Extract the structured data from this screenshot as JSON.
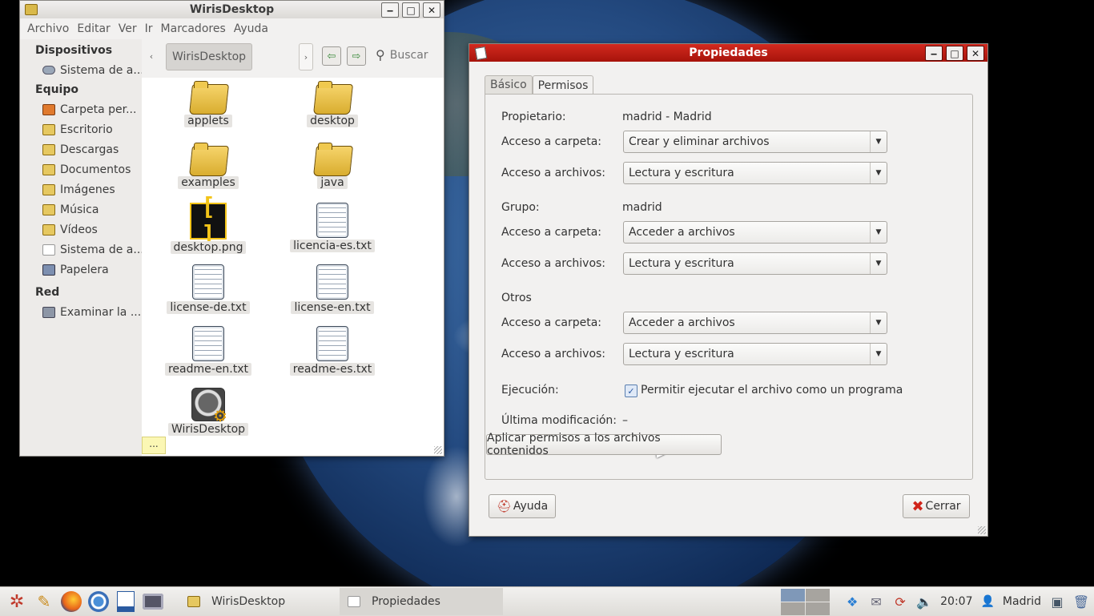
{
  "file_manager": {
    "title": "WirisDesktop",
    "menu": [
      "Archivo",
      "Editar",
      "Ver",
      "Ir",
      "Marcadores",
      "Ayuda"
    ],
    "path_current": "WirisDesktop",
    "search_label": "Buscar",
    "sidebar": {
      "devices_header": "Dispositivos",
      "devices": [
        {
          "label": "Sistema de a...",
          "icon": "drive-icon"
        }
      ],
      "places_header": "Equipo",
      "places": [
        {
          "label": "Carpeta per...",
          "icon": "home-folder-icon"
        },
        {
          "label": "Escritorio",
          "icon": "desktop-folder-icon"
        },
        {
          "label": "Descargas",
          "icon": "folder-icon"
        },
        {
          "label": "Documentos",
          "icon": "folder-icon"
        },
        {
          "label": "Imágenes",
          "icon": "folder-icon"
        },
        {
          "label": "Música",
          "icon": "folder-icon"
        },
        {
          "label": "Vídeos",
          "icon": "folder-icon"
        },
        {
          "label": "Sistema de a...",
          "icon": "filesystem-icon"
        },
        {
          "label": "Papelera",
          "icon": "trash-icon"
        }
      ],
      "network_header": "Red",
      "network": [
        {
          "label": "Examinar la ...",
          "icon": "network-icon"
        }
      ]
    },
    "files": [
      {
        "name": "applets",
        "kind": "folder"
      },
      {
        "name": "desktop",
        "kind": "folder"
      },
      {
        "name": "examples",
        "kind": "folder"
      },
      {
        "name": "java",
        "kind": "folder"
      },
      {
        "name": "desktop.png",
        "kind": "image"
      },
      {
        "name": "licencia-es.txt",
        "kind": "text"
      },
      {
        "name": "license-de.txt",
        "kind": "text"
      },
      {
        "name": "license-en.txt",
        "kind": "text"
      },
      {
        "name": "readme-en.txt",
        "kind": "text"
      },
      {
        "name": "readme-es.txt",
        "kind": "text"
      },
      {
        "name": "WirisDesktop",
        "kind": "executable"
      }
    ],
    "tooltip": "..."
  },
  "properties": {
    "title": "Propiedades",
    "tabs": [
      "Básico",
      "Permisos"
    ],
    "owner_label": "Propietario:",
    "owner_value": "madrid - Madrid",
    "owner_folder_label": "Acceso a carpeta:",
    "owner_folder_value": "Crear y eliminar archivos",
    "owner_files_label": "Acceso a archivos:",
    "owner_files_value": "Lectura y escritura",
    "group_label": "Grupo:",
    "group_value": "madrid",
    "group_folder_label": "Acceso a carpeta:",
    "group_folder_value": "Acceder a archivos",
    "group_files_label": "Acceso a archivos:",
    "group_files_value": "Lectura y escritura",
    "others_label": "Otros",
    "others_folder_label": "Acceso a carpeta:",
    "others_folder_value": "Acceder a archivos",
    "others_files_label": "Acceso a archivos:",
    "others_files_value": "Lectura y escritura",
    "exec_label": "Ejecución:",
    "exec_checkbox_label": "Permitir ejecutar el archivo como un programa",
    "exec_checked": true,
    "modified_label": "Última modificación:",
    "modified_value": "–",
    "apply_button": "Aplicar permisos a los archivos contenidos",
    "help_button": "Ayuda",
    "close_button": "Cerrar"
  },
  "taskbar": {
    "tasks": [
      {
        "label": "WirisDesktop",
        "icon": "folder-icon"
      },
      {
        "label": "Propiedades",
        "icon": "properties-icon"
      }
    ],
    "clock": "20:07",
    "user": "Madrid"
  }
}
